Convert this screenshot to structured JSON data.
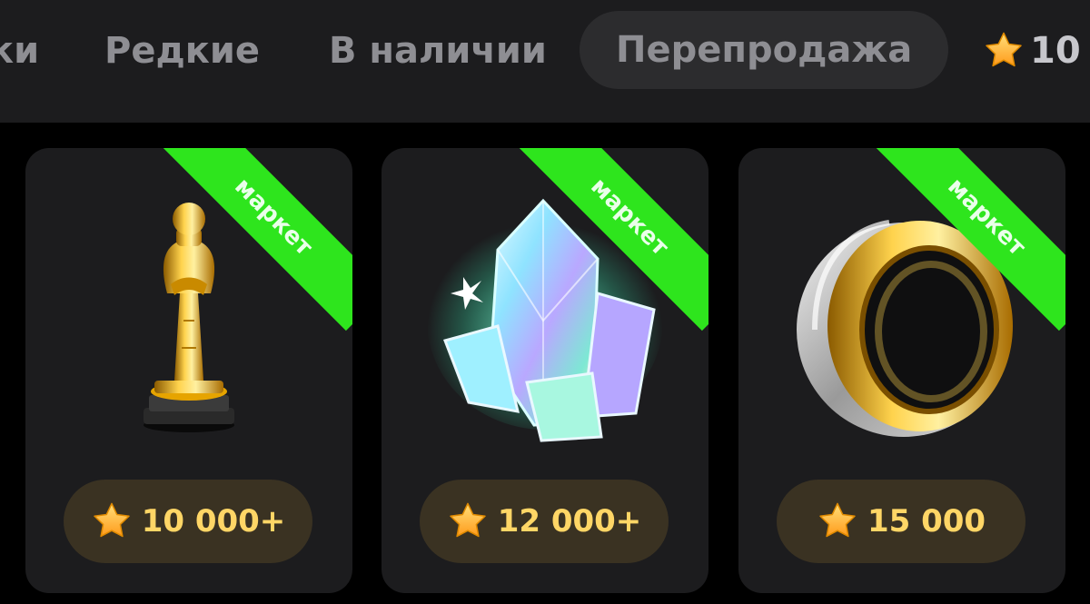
{
  "tabs": [
    {
      "label": "ки"
    },
    {
      "label": "Редкие"
    },
    {
      "label": "В наличии"
    },
    {
      "label": "Перепродажа",
      "active": true
    }
  ],
  "balance": {
    "icon": "star-icon",
    "value": "10"
  },
  "cards": [
    {
      "gift": "trophy",
      "icon": "trophy-icon",
      "badge": "маркет",
      "price": "10 000+",
      "price_icon": "star-icon"
    },
    {
      "gift": "crystal",
      "icon": "crystal-icon",
      "badge": "маркет",
      "price": "12 000+",
      "price_icon": "star-icon"
    },
    {
      "gift": "ring",
      "icon": "ring-icon",
      "badge": "маркет",
      "price": "15 000",
      "price_icon": "star-icon"
    }
  ],
  "colors": {
    "background": "#000000",
    "panel": "#1c1c1e",
    "tab_text": "#8e8e93",
    "active_tab_bg": "#2c2c2e",
    "badge": "#2ee51d",
    "price_pill": "#3a3222",
    "price_text": "#ffd666",
    "star": "#ffb020"
  }
}
